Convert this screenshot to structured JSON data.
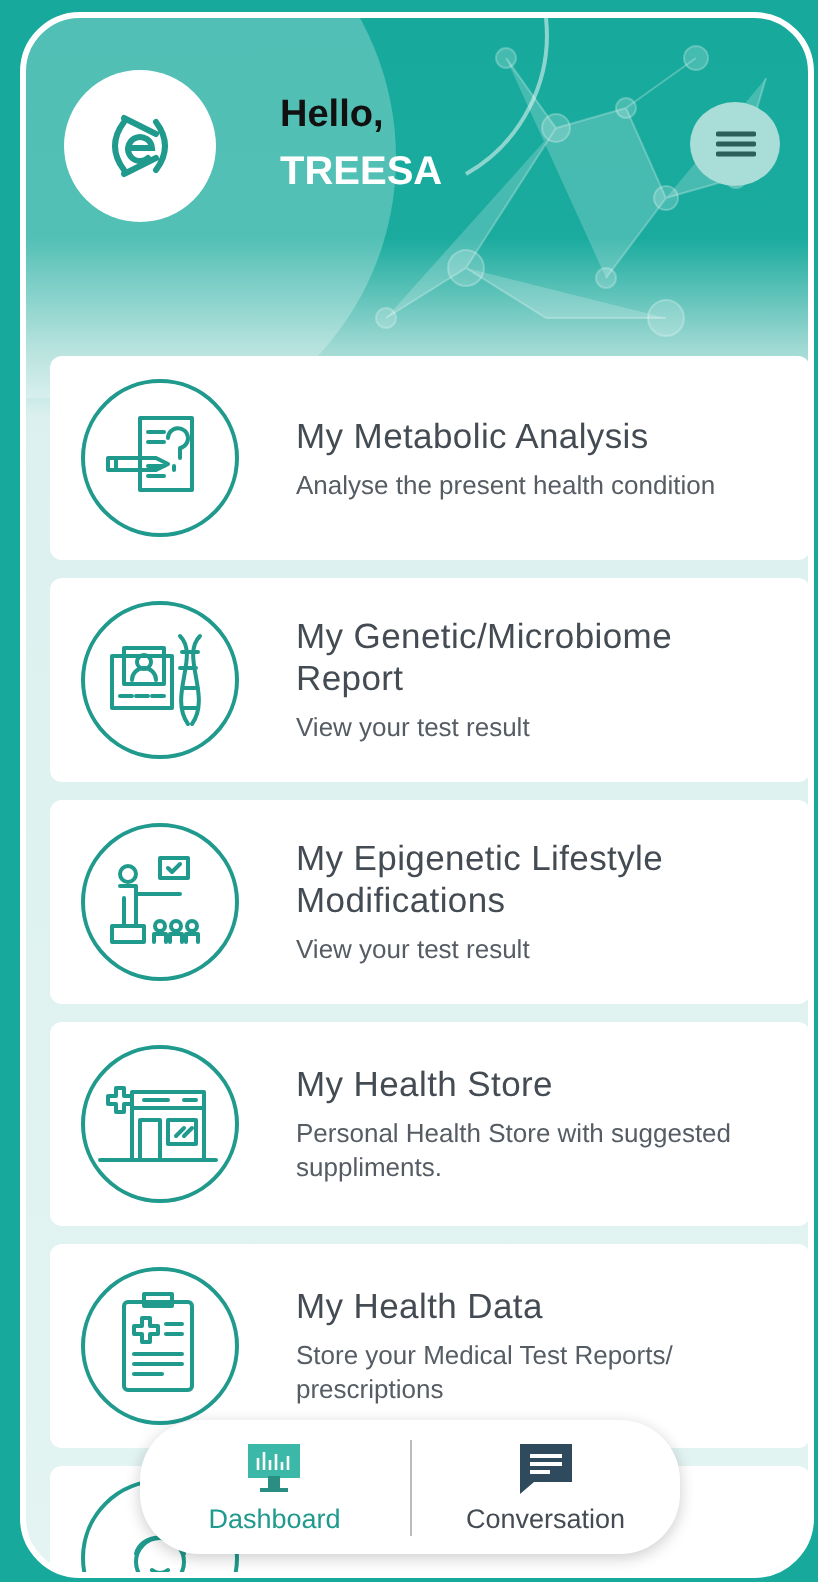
{
  "header": {
    "greeting": "Hello,",
    "user_name": "TREESA"
  },
  "features": [
    {
      "kind": "metabolic",
      "title": "My Metabolic Analysis",
      "subtitle": "Analyse the present health condition"
    },
    {
      "kind": "genetic",
      "title": "My Genetic/Microbiome Report",
      "subtitle": "View your test result"
    },
    {
      "kind": "epigenetic",
      "title": "My Epigenetic Lifestyle Modifications",
      "subtitle": "View your test result"
    },
    {
      "kind": "store",
      "title": "My Health Store",
      "subtitle": "Personal Health Store with suggested suppliments."
    },
    {
      "kind": "data",
      "title": "My Health Data",
      "subtitle": "Store your Medical Test Reports/ prescriptions"
    },
    {
      "kind": "doctor"
    }
  ],
  "bottom_nav": [
    {
      "kind": "dashboard",
      "label": "Dashboard",
      "selected": true
    },
    {
      "kind": "conversation",
      "label": "Conversation",
      "selected": false
    }
  ]
}
